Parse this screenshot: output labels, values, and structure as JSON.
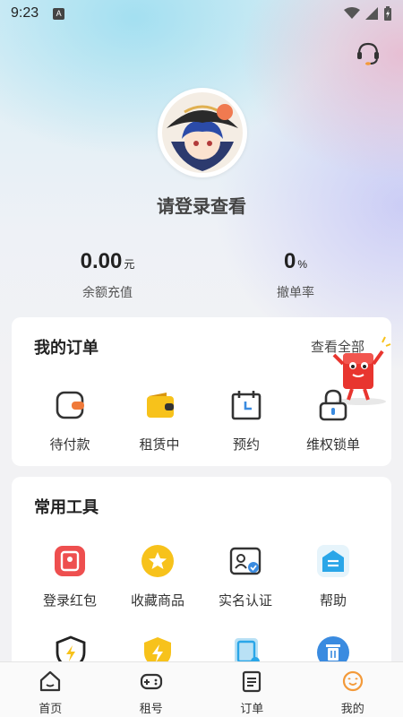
{
  "status_bar": {
    "time": "9:23",
    "badge": "A"
  },
  "profile": {
    "login_prompt": "请登录查看"
  },
  "stats": [
    {
      "value": "0.00",
      "unit": "元",
      "label": "余额充值"
    },
    {
      "value": "0",
      "unit": "%",
      "label": "撤单率"
    }
  ],
  "orders": {
    "title": "我的订单",
    "view_all": "查看全部",
    "items": [
      {
        "label": "待付款",
        "icon": "wallet-pending-icon"
      },
      {
        "label": "租赁中",
        "icon": "wallet-icon"
      },
      {
        "label": "预约",
        "icon": "calendar-icon"
      },
      {
        "label": "维权锁单",
        "icon": "lock-icon"
      }
    ]
  },
  "tools": {
    "title": "常用工具",
    "items": [
      {
        "label": "登录红包",
        "icon": "red-packet-icon"
      },
      {
        "label": "收藏商品",
        "icon": "star-icon"
      },
      {
        "label": "实名认证",
        "icon": "id-card-icon"
      },
      {
        "label": "帮助",
        "icon": "help-box-icon"
      }
    ]
  },
  "tab_bar": {
    "items": [
      {
        "label": "首页",
        "icon": "home-icon"
      },
      {
        "label": "租号",
        "icon": "gamepad-icon"
      },
      {
        "label": "订单",
        "icon": "clipboard-icon"
      },
      {
        "label": "我的",
        "icon": "smiley-icon",
        "active": true
      }
    ]
  },
  "colors": {
    "accent_orange": "#f39a3a",
    "card_bg": "#ffffff",
    "red": "#ee4f4f",
    "yellow": "#f7c21b",
    "blue": "#3a8be0"
  }
}
